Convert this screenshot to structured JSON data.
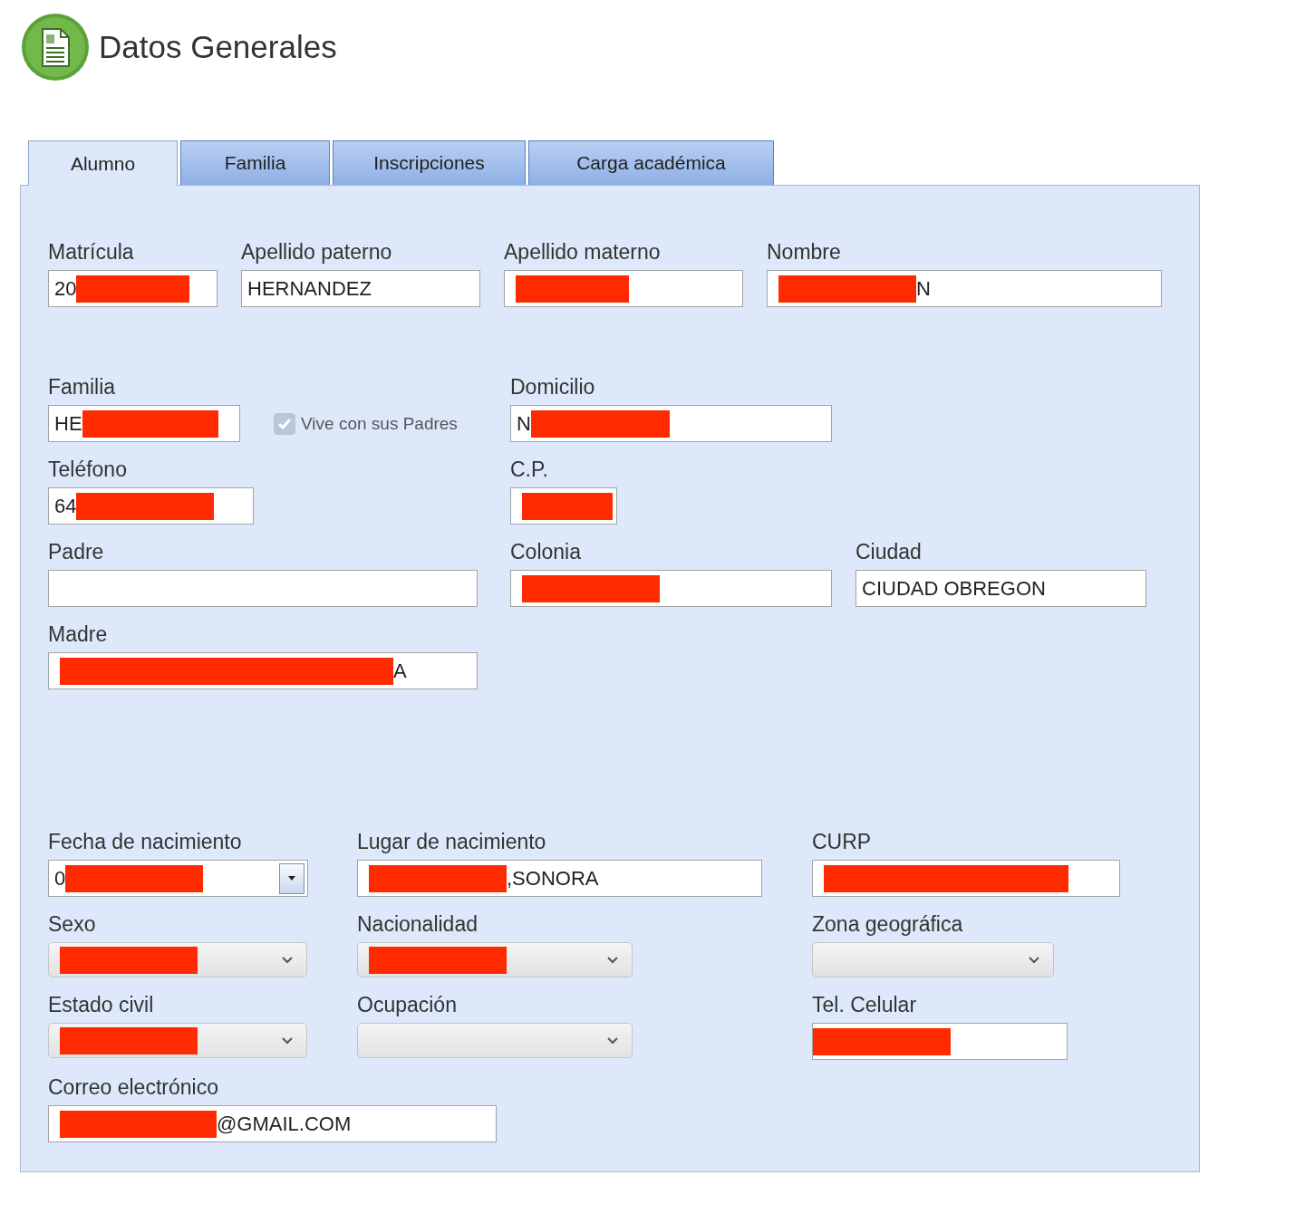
{
  "header": {
    "title": "Datos Generales"
  },
  "tabs": [
    {
      "label": "Alumno",
      "selected": true
    },
    {
      "label": "Familia",
      "selected": false
    },
    {
      "label": "Inscripciones",
      "selected": false
    },
    {
      "label": "Carga académica",
      "selected": false
    }
  ],
  "groups": [
    {
      "rows": [
        [
          {
            "kind": "text",
            "label": "Matrícula",
            "prefix": "20",
            "redacted": true
          },
          {
            "kind": "text",
            "label": "Apellido paterno",
            "prefix": "HERNANDEZ"
          },
          {
            "kind": "text",
            "label": "Apellido materno",
            "redacted": true
          },
          {
            "kind": "text",
            "label": "Nombre",
            "redacted": true,
            "suffix": "N"
          }
        ]
      ]
    },
    {
      "rows": [
        [
          {
            "kind": "text",
            "label": "Familia",
            "prefix": "HE",
            "redacted": true,
            "option": {
              "label": "Vive con sus Padres",
              "checked": true,
              "disabled": true
            }
          },
          {
            "kind": "text",
            "label": "Domicilio",
            "prefix": "N",
            "redacted": true
          }
        ],
        [
          {
            "kind": "text",
            "label": "Teléfono",
            "prefix": "64",
            "redacted": true
          },
          {
            "kind": "text",
            "label": "C.P.",
            "redacted": true
          }
        ],
        [
          {
            "kind": "text",
            "label": "Padre"
          },
          {
            "kind": "text",
            "label": "Colonia",
            "redacted": true
          },
          {
            "kind": "text",
            "label": "Ciudad",
            "prefix": "CIUDAD OBREGON"
          }
        ],
        [
          {
            "kind": "text",
            "label": "Madre",
            "redacted": true,
            "suffix": "A"
          }
        ]
      ]
    },
    {
      "rows": [
        [
          {
            "kind": "date",
            "label": "Fecha de nacimiento",
            "prefix": "0",
            "redacted": true
          },
          {
            "kind": "text",
            "label": "Lugar de nacimiento",
            "redacted": true,
            "suffix": ",SONORA"
          },
          {
            "kind": "text",
            "label": "CURP",
            "redacted": true
          }
        ],
        [
          {
            "kind": "select",
            "label": "Sexo",
            "redacted": true,
            "disabled": true
          },
          {
            "kind": "select",
            "label": "Nacionalidad",
            "redacted": true,
            "disabled": true
          },
          {
            "kind": "select",
            "label": "Zona geográfica",
            "disabled": true
          }
        ],
        [
          {
            "kind": "select",
            "label": "Estado civil",
            "redacted": true,
            "disabled": true
          },
          {
            "kind": "select",
            "label": "Ocupación",
            "disabled": true
          },
          {
            "kind": "text",
            "label": "Tel. Celular",
            "redacted": true
          }
        ],
        [
          {
            "kind": "text",
            "label": "Correo electrónico",
            "redacted": true,
            "suffix": "@GMAIL.COM"
          }
        ]
      ]
    }
  ]
}
